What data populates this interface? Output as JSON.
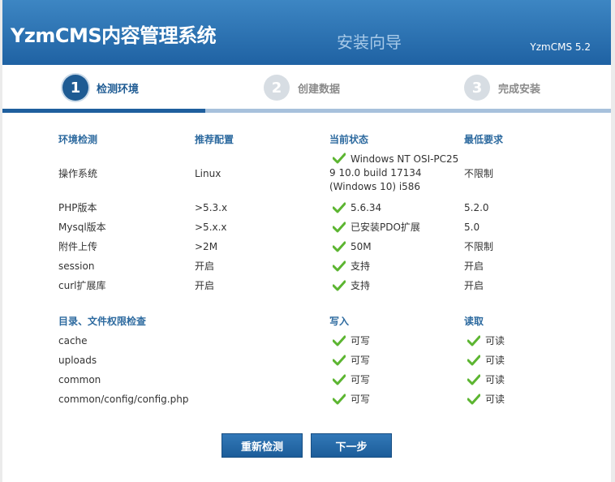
{
  "header": {
    "logo": "YzmCMS内容管理系统",
    "title": "安装向导",
    "version": "YzmCMS 5.2"
  },
  "steps": [
    {
      "num": "1",
      "label": "检测环境",
      "active": true
    },
    {
      "num": "2",
      "label": "创建数据",
      "active": false
    },
    {
      "num": "3",
      "label": "完成安装",
      "active": false
    }
  ],
  "progress_fraction": 0.333,
  "env": {
    "headers": [
      "环境检测",
      "推荐配置",
      "当前状态",
      "最低要求"
    ],
    "rows": [
      {
        "name": "操作系统",
        "recommended": "Linux",
        "current": "Windows NT OSI-PC25 9 10.0 build 17134 (Windows 10) i586",
        "min": "不限制"
      },
      {
        "name": "PHP版本",
        "recommended": ">5.3.x",
        "current": "5.6.34",
        "min": "5.2.0"
      },
      {
        "name": "Mysql版本",
        "recommended": ">5.x.x",
        "current": "已安装PDO扩展",
        "min": "5.0"
      },
      {
        "name": "附件上传",
        "recommended": ">2M",
        "current": "50M",
        "min": "不限制"
      },
      {
        "name": "session",
        "recommended": "开启",
        "current": "支持",
        "min": "开启"
      },
      {
        "name": "curl扩展库",
        "recommended": "开启",
        "current": "支持",
        "min": "开启"
      }
    ]
  },
  "perms": {
    "headers": [
      "目录、文件权限检查",
      "写入",
      "读取"
    ],
    "rows": [
      {
        "path": "cache",
        "write": "可写",
        "read": "可读"
      },
      {
        "path": "uploads",
        "write": "可写",
        "read": "可读"
      },
      {
        "path": "common",
        "write": "可写",
        "read": "可读"
      },
      {
        "path": "common/config/config.php",
        "write": "可写",
        "read": "可读"
      }
    ]
  },
  "buttons": {
    "recheck": "重新检测",
    "next": "下一步"
  },
  "colors": {
    "header_top": "#3d86c3",
    "header_bottom": "#1f62a3",
    "accent": "#1e5b93",
    "check": "#5cb531"
  }
}
